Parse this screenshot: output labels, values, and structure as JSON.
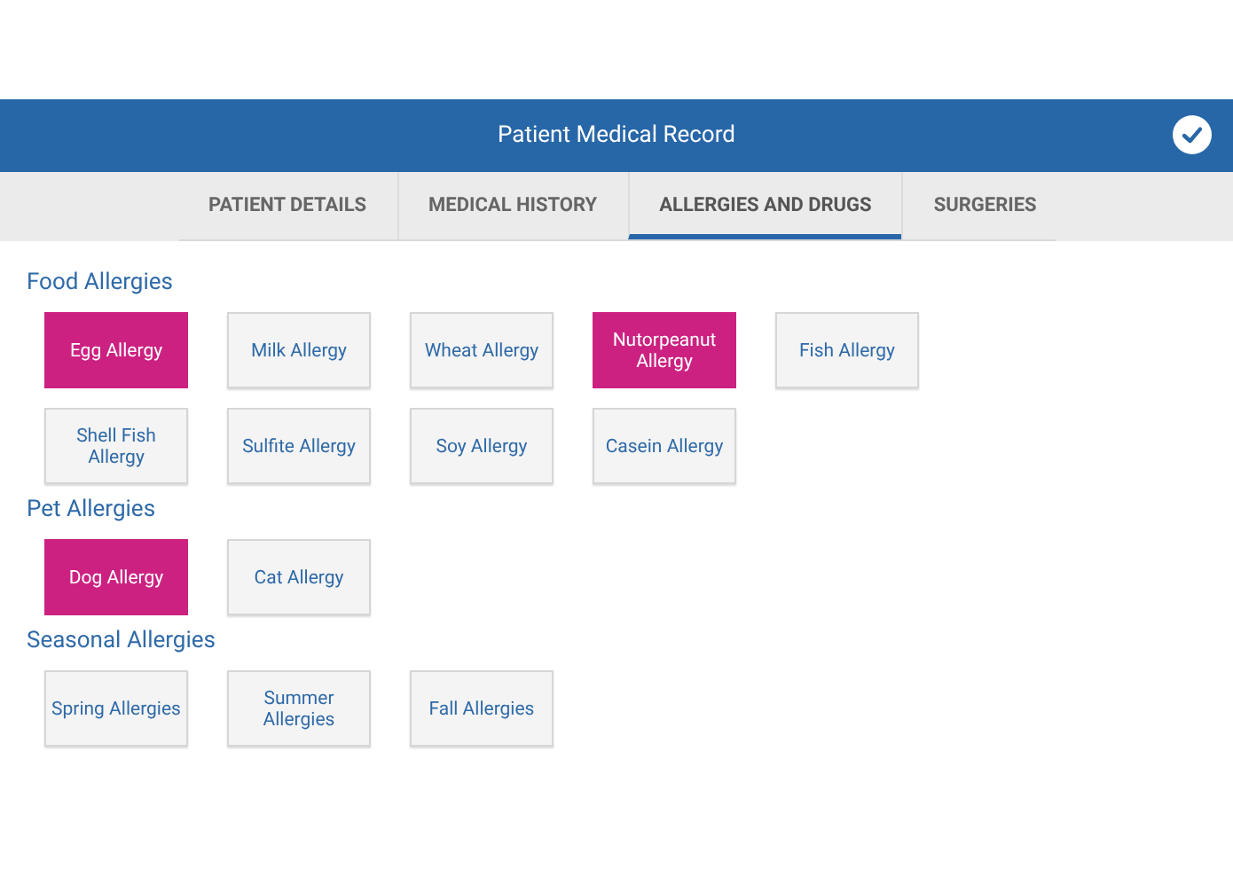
{
  "header": {
    "title": "Patient Medical Record"
  },
  "tabs": [
    {
      "label": "PATIENT DETAILS",
      "selected": false
    },
    {
      "label": "MEDICAL HISTORY",
      "selected": false
    },
    {
      "label": "ALLERGIES AND DRUGS",
      "selected": true
    },
    {
      "label": "SURGERIES",
      "selected": false
    }
  ],
  "sections": [
    {
      "title": "Food Allergies",
      "options": [
        {
          "label": "Egg Allergy",
          "selected": true
        },
        {
          "label": "Milk Allergy",
          "selected": false
        },
        {
          "label": "Wheat Allergy",
          "selected": false
        },
        {
          "label": "Nutorpeanut Allergy",
          "selected": true
        },
        {
          "label": "Fish Allergy",
          "selected": false
        },
        {
          "label": "Shell Fish Allergy",
          "selected": false
        },
        {
          "label": "Sulfite Allergy",
          "selected": false
        },
        {
          "label": "Soy Allergy",
          "selected": false
        },
        {
          "label": "Casein Allergy",
          "selected": false
        }
      ]
    },
    {
      "title": "Pet Allergies",
      "options": [
        {
          "label": "Dog Allergy",
          "selected": true
        },
        {
          "label": "Cat Allergy",
          "selected": false
        }
      ]
    },
    {
      "title": "Seasonal Allergies",
      "options": [
        {
          "label": "Spring Allergies",
          "selected": false
        },
        {
          "label": "Summer Allergies",
          "selected": false
        },
        {
          "label": "Fall Allergies",
          "selected": false
        }
      ]
    }
  ]
}
